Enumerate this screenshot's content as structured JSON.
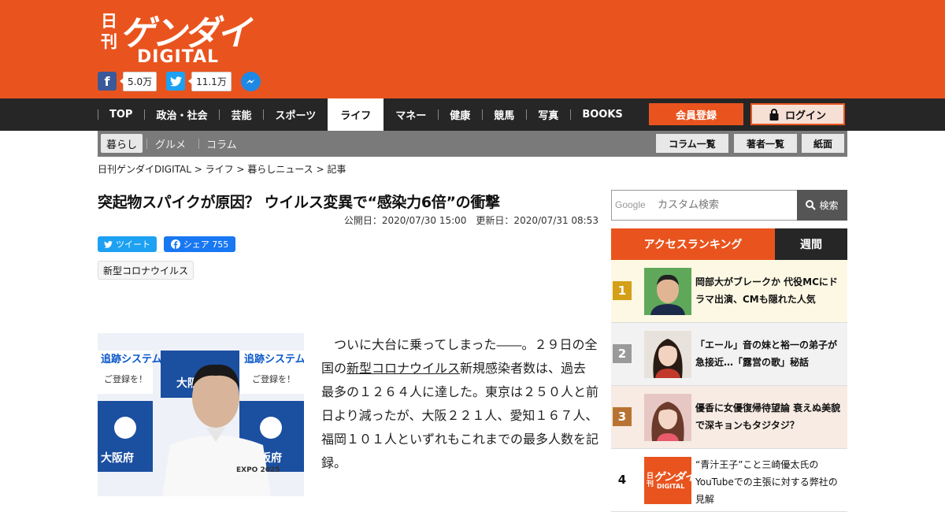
{
  "site": {
    "logo_kanji": "日刊",
    "logo_kana": "ゲンダイ",
    "logo_digital": "DIGITAL",
    "facebook_count": "5.0万",
    "twitter_count": "11.1万"
  },
  "nav": {
    "items": [
      {
        "label": "TOP"
      },
      {
        "label": "政治・社会"
      },
      {
        "label": "芸能"
      },
      {
        "label": "スポーツ"
      },
      {
        "label": "ライフ",
        "active": true
      },
      {
        "label": "マネー"
      },
      {
        "label": "健康"
      },
      {
        "label": "競馬"
      },
      {
        "label": "写真"
      },
      {
        "label": "BOOKS"
      }
    ],
    "member_label": "会員登録",
    "login_label": "ログイン"
  },
  "subnav": {
    "items": [
      {
        "label": "暮らし",
        "active": true
      },
      {
        "label": "グルメ"
      },
      {
        "label": "コラム"
      }
    ],
    "buttons": [
      {
        "label": "コラム一覧"
      },
      {
        "label": "著者一覧"
      },
      {
        "label": "紙面"
      }
    ]
  },
  "breadcrumb": "日刊ゲンダイDIGITAL > ライフ > 暮らしニュース > 記事",
  "article": {
    "title": "突起物スパイクが原因？ ウイルス変異で“感染力6倍”の衝撃",
    "dates": "公開日：2020/07/30 15:00　更新日：2020/07/31 08:53",
    "tweet_label": "ツイート",
    "fb_share_label": "シェア 755",
    "tag": "新型コロナウイルス",
    "body_1": "ついに大台に乗ってしまった――。２９日の全国の",
    "body_link": "新型コロナウイルス",
    "body_2": "新規感染者数は、過去最多の１２６４人に達した。東京は２５０人と前日より減ったが、大阪２２１人、愛知１６７人、福岡１０１人といずれもこれまでの最多人数を記録。",
    "photo_text": {
      "tsuiseki": "追跡システム",
      "touroku": "ご登録を！",
      "osaka": "大阪府",
      "expo": "EXPO 2025"
    }
  },
  "search": {
    "google_label": "Google",
    "placeholder": "カスタム検索",
    "button_label": "検索"
  },
  "ranking": {
    "tab_label": "アクセスランキング",
    "period_label": "週間",
    "items": [
      {
        "rank": "1",
        "text": "岡部大がブレークか 代役MCにドラマ出演、CMも隠れた人気",
        "color": "#d4a017",
        "bg": "#fdf8e4"
      },
      {
        "rank": "2",
        "text": "「エール」音の妹と裕一の弟子が急接近…「露営の歌」秘話",
        "color": "#9a9a9a",
        "bg": "#f2f2f2"
      },
      {
        "rank": "3",
        "text": "優香に女優復帰待望論 衰えぬ美貌で深キョンもタジタジ？",
        "color": "#b87333",
        "bg": "#f7ebe3"
      },
      {
        "rank": "4",
        "text": "“青汁王子”こと三崎優太氏のYouTubeでの主張に対する弊社の見解",
        "color": "#fff",
        "bg": "#ffffff"
      }
    ]
  }
}
